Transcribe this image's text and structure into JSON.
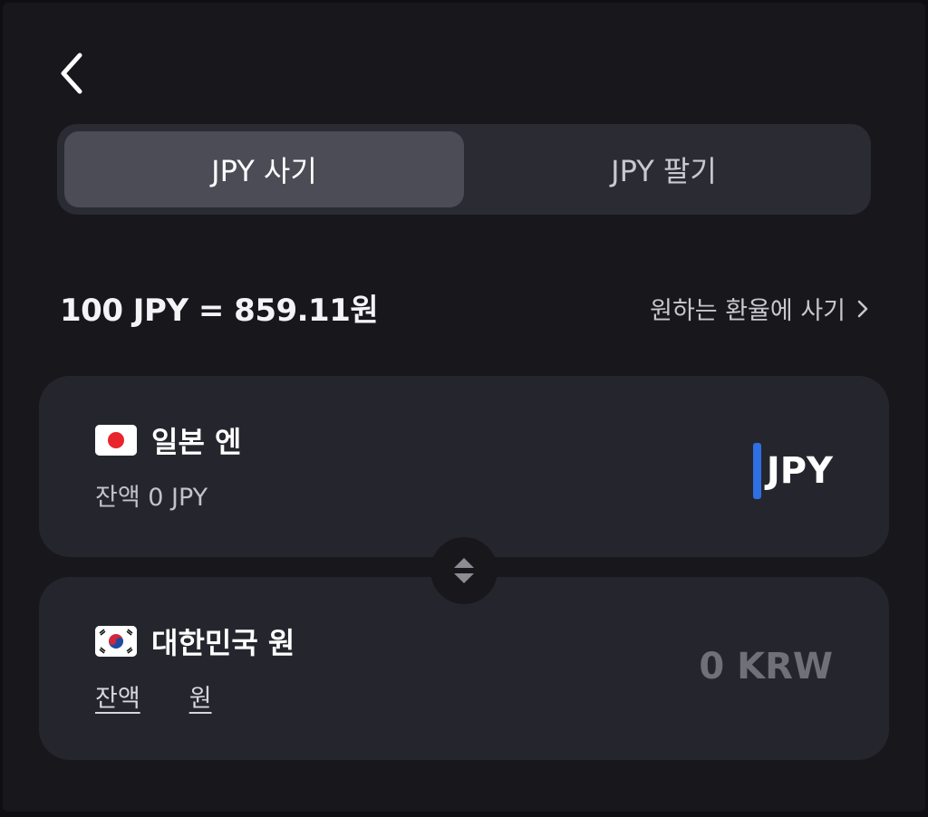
{
  "nav": {
    "back_icon": "chevron-left-icon"
  },
  "tabs": [
    {
      "label": "JPY 사기",
      "active": true
    },
    {
      "label": "JPY 팔기",
      "active": false
    }
  ],
  "rate": {
    "text": "100 JPY = 859.11원",
    "link_label": "원하는 환율에 사기",
    "link_icon": "chevron-right-icon"
  },
  "from_currency": {
    "flag_icon": "japan-flag-icon",
    "name": "일본 엔",
    "balance": "잔액 0 JPY",
    "amount_unit": "JPY",
    "caret_color": "#2f6fe4"
  },
  "swap": {
    "icon": "swap-vertical-icon"
  },
  "to_currency": {
    "flag_icon": "korea-flag-icon",
    "name": "대한민국 원",
    "balance_prefix": "잔액",
    "balance_unit": "원",
    "amount": "0 KRW"
  },
  "colors": {
    "background": "#17171c",
    "card": "#25262d",
    "tab_active": "#4b4c55",
    "accent": "#2f6fe4"
  }
}
